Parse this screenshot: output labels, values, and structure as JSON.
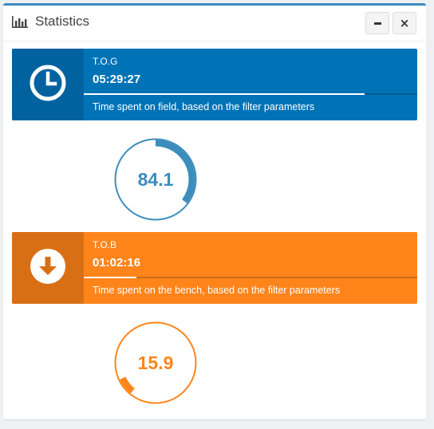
{
  "panel": {
    "title": "Statistics",
    "title_icon": "bar-chart-icon",
    "minimize_icon": "minus-icon",
    "close_icon": "close-icon",
    "close_glyph": "×"
  },
  "tog": {
    "label": "T.O.G",
    "value": "05:29:27",
    "progress_fraction": 0.841,
    "description": "Time spent on field, based on the filter parameters",
    "icon": "clock-icon",
    "color": "#0073b7",
    "icon_bg": "#0262a0"
  },
  "tob": {
    "label": "T.O.B",
    "value": "01:02:16",
    "progress_fraction": 0.159,
    "description": "Time spent on the bench, based on the filter parameters",
    "icon": "arrow-down-circle-icon",
    "color": "#ff851b",
    "icon_bg": "#d96f15"
  },
  "knobs": {
    "tog_value": "84.1",
    "tob_value": "15.9",
    "tog_percent": 84.1,
    "tob_percent": 15.9,
    "tog_color": "#3c8dbc",
    "tob_color": "#ff851b"
  }
}
